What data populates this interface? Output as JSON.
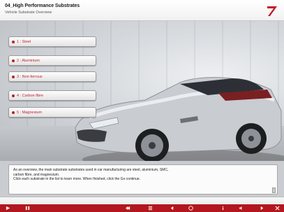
{
  "header": {
    "title": "04_High Performance Substrates",
    "subtitle": "Vehicle Substrate Overview"
  },
  "menu": {
    "items": [
      {
        "label": "1 : Steel"
      },
      {
        "label": "2 : Aluminium"
      },
      {
        "label": "3 : Non-ferrous"
      },
      {
        "label": "4 : Carbon fibre"
      },
      {
        "label": "5 : Magnesium"
      }
    ]
  },
  "panel": {
    "line1": "As an overview, the main substrate substrates used in car manufacturing are steel, aluminium, SMC,",
    "line2": "carbon fibre, and magnesium.",
    "line3": "Click each substrate in the list to learn more. When finished, click the Go continue."
  },
  "colors": {
    "accent": "#c21f2c",
    "redbar": "#b3161e"
  }
}
